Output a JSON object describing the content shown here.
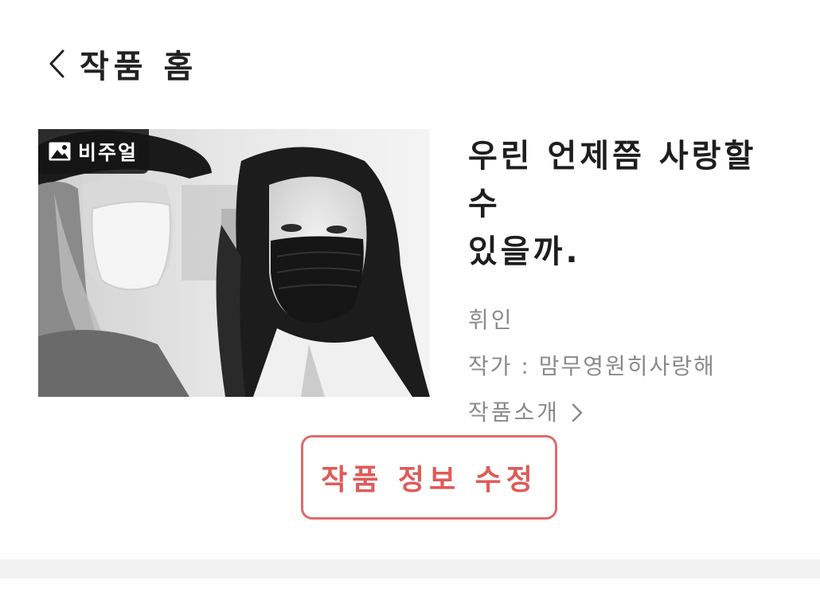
{
  "header": {
    "back_icon": "chevron-left-icon",
    "title": "작품 홈"
  },
  "cover": {
    "badge_icon": "image-icon",
    "badge_label": "비주얼"
  },
  "work": {
    "title_line1": "우린 언제쯤 사랑할 수",
    "title_line2": "있을까.",
    "genre": "휘인",
    "author": "작가 : 맘무영원히사랑해",
    "intro_label": "작품소개",
    "intro_icon": "chevron-right-icon"
  },
  "actions": {
    "edit_label": "작품 정보 수정"
  },
  "colors": {
    "accent": "#e05a5a",
    "muted_text": "#8a8a8a",
    "divider": "#f2f2f3"
  }
}
